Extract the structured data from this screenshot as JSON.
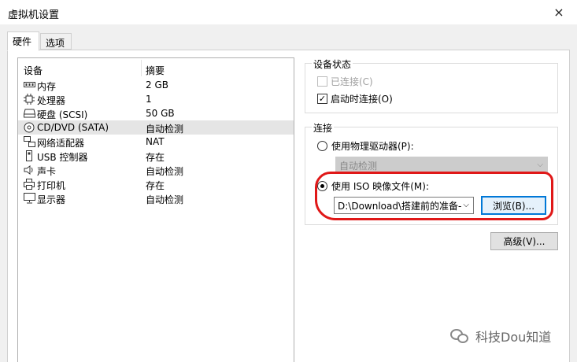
{
  "window": {
    "title": "虚拟机设置",
    "close_icon": "×"
  },
  "tabs": [
    {
      "label": "硬件"
    },
    {
      "label": "选项"
    }
  ],
  "device_list": {
    "headers": {
      "device": "设备",
      "summary": "摘要"
    },
    "rows": [
      {
        "icon": "memory-icon",
        "name": "内存",
        "summary": "2 GB"
      },
      {
        "icon": "processor-icon",
        "name": "处理器",
        "summary": "1"
      },
      {
        "icon": "hard-disk-icon",
        "name": "硬盘 (SCSI)",
        "summary": "50 GB"
      },
      {
        "icon": "cd-dvd-icon",
        "name": "CD/DVD (SATA)",
        "summary": "自动检测",
        "selected": true
      },
      {
        "icon": "network-adapter-icon",
        "name": "网络适配器",
        "summary": "NAT"
      },
      {
        "icon": "usb-icon",
        "name": "USB 控制器",
        "summary": "存在"
      },
      {
        "icon": "sound-card-icon",
        "name": "声卡",
        "summary": "自动检测"
      },
      {
        "icon": "printer-icon",
        "name": "打印机",
        "summary": "存在"
      },
      {
        "icon": "display-icon",
        "name": "显示器",
        "summary": "自动检测"
      }
    ]
  },
  "device_status": {
    "title": "设备状态",
    "connected": {
      "label": "已连接(C)",
      "checked": false,
      "disabled": true
    },
    "connect_at_power_on": {
      "label": "启动时连接(O)",
      "checked": true
    }
  },
  "connection": {
    "title": "连接",
    "physical_drive": {
      "label": "使用物理驱动器(P):",
      "selected": false,
      "dropdown_value": "自动检测"
    },
    "iso_image": {
      "label": "使用 ISO 映像文件(M):",
      "selected": true,
      "path": "D:\\Download\\搭建前的准备-"
    },
    "browse_label": "浏览(B)..."
  },
  "advanced_label": "高级(V)...",
  "watermark": "科技Dou知道",
  "colors": {
    "accent": "#0078d7",
    "highlight_circle": "#e01818",
    "selected_row": "#e5e5e5"
  }
}
